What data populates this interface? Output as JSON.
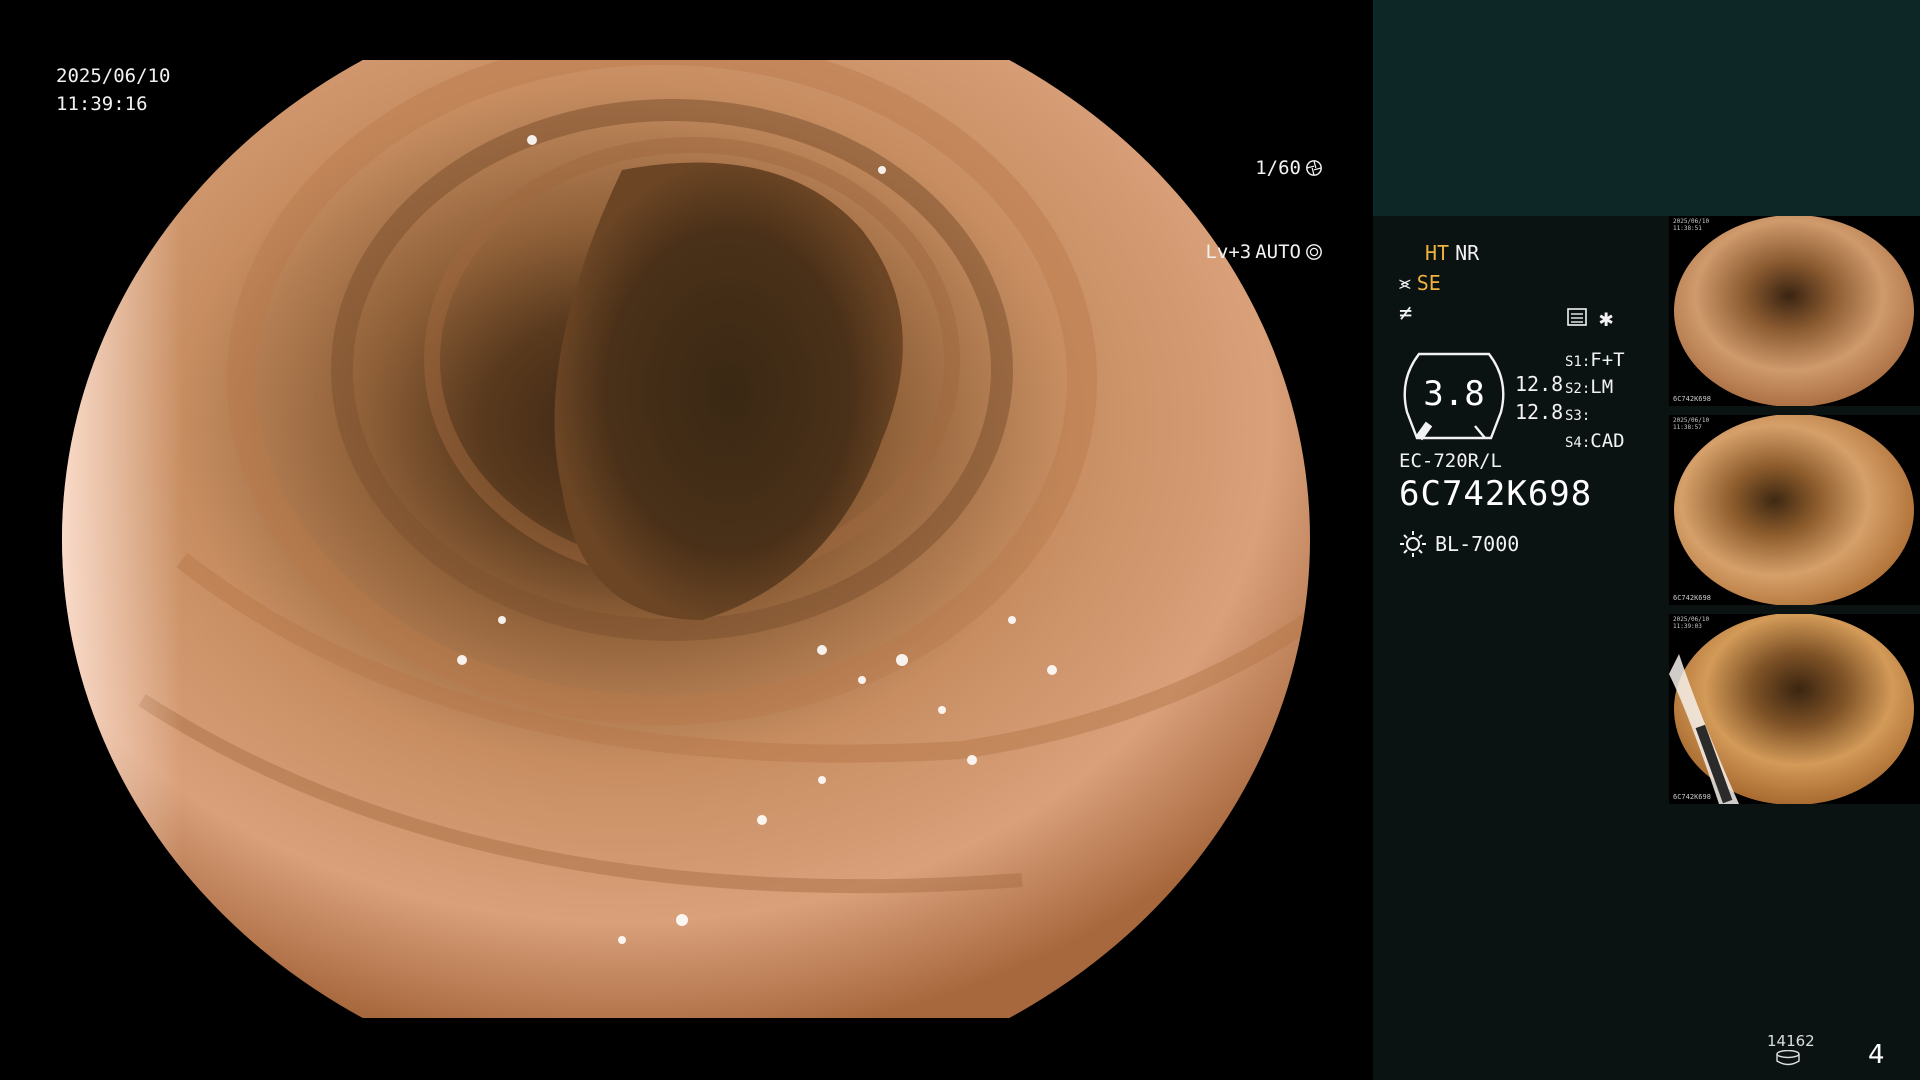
{
  "osd": {
    "date": "2025/06/10",
    "time": "11:39:16",
    "shutter": "1/60",
    "level": "Lv+3",
    "mode": "AUTO"
  },
  "side": {
    "ht": "HT",
    "nr": "NR",
    "se": "SE",
    "gauge_value": "3.8",
    "gauge_sub_1": "12.8",
    "gauge_sub_2": "12.8",
    "slots": [
      {
        "key": "S1",
        "value": "F+T"
      },
      {
        "key": "S2",
        "value": "LM"
      },
      {
        "key": "S3",
        "value": ""
      },
      {
        "key": "S4",
        "value": "CAD"
      }
    ],
    "model": "EC-720R/L",
    "serial": "6C742K698",
    "light_source": "BL-7000"
  },
  "thumbnails": [
    {
      "date": "2025/06/10",
      "time": "11:38:51",
      "serial": "6C742K698"
    },
    {
      "date": "2025/06/10",
      "time": "11:38:57",
      "serial": "6C742K698"
    },
    {
      "date": "2025/06/10",
      "time": "11:39:03",
      "serial": "6C742K698"
    }
  ],
  "footer": {
    "counter": "14162",
    "page": "4"
  },
  "colors": {
    "accent": "#f0b23e",
    "panel_top": "#0d2626",
    "panel": "#0a1212"
  }
}
